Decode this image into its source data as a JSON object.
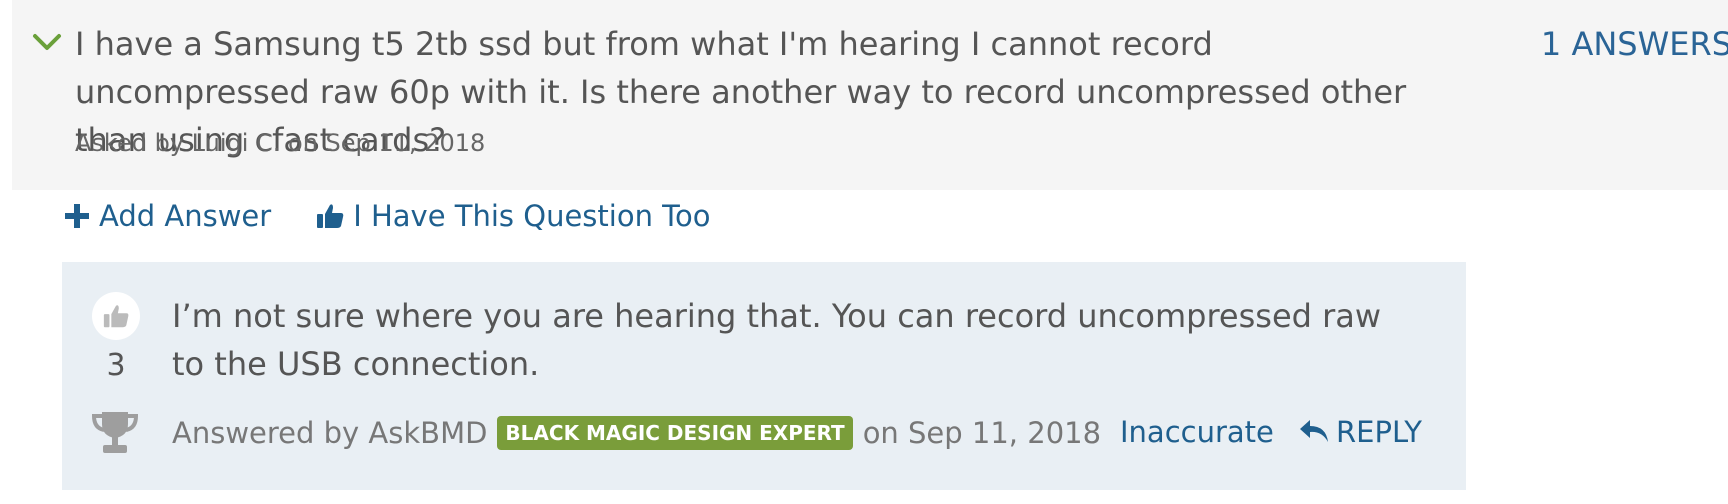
{
  "question": {
    "text": "I have a Samsung t5 2tb ssd but from what I'm hearing I cannot record uncompressed raw 60p with it. Is there another way to record uncompressed other than using cfast cards?",
    "answers_count": "1 ANSWERS",
    "asked_by": "Asked by Luigi C. on Sep 11, 2018"
  },
  "actions": {
    "add_answer": "Add Answer",
    "have_question": "I Have This Question Too"
  },
  "answer": {
    "votes": "3",
    "text": "I’m not sure where you are hearing that. You can record uncompressed raw to the USB connection.",
    "answered_by_prefix": "Answered by AskBMD",
    "badge": "BLACK MAGIC DESIGN EXPERT",
    "date": "on Sep 11, 2018",
    "inaccurate": "Inaccurate",
    "reply": "REPLY"
  },
  "colors": {
    "accent_green": "#6aa03a",
    "link_blue": "#1f5f8e",
    "badge_green": "#7a9d3a",
    "answer_bg": "#e9eff4",
    "question_bg": "#f5f5f5"
  },
  "icons": {
    "expand": "chevron-down-icon",
    "add": "plus-icon",
    "like": "thumbs-up-icon",
    "trophy": "trophy-icon",
    "reply": "reply-arrow-icon"
  }
}
